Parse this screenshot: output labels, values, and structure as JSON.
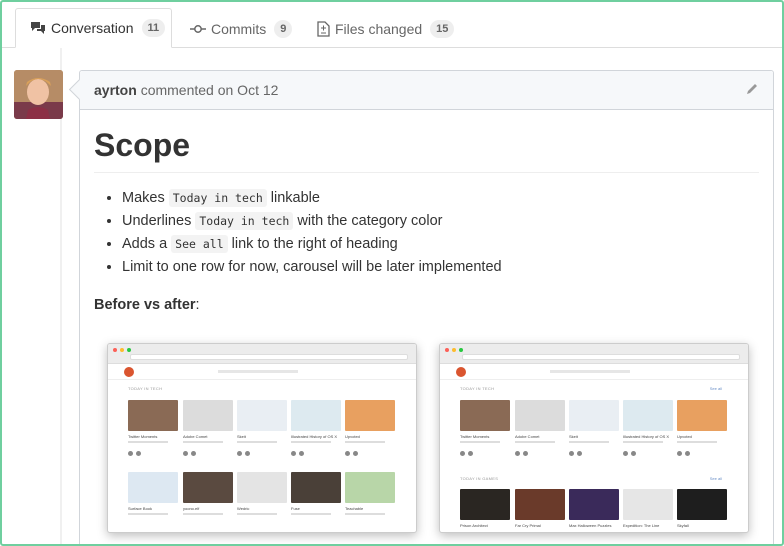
{
  "tabs": [
    {
      "label": "Conversation",
      "count": "11",
      "icon": "conversation-icon"
    },
    {
      "label": "Commits",
      "count": "9",
      "icon": "commit-icon"
    },
    {
      "label": "Files changed",
      "count": "15",
      "icon": "file-diff-icon"
    }
  ],
  "comment": {
    "author": "ayrton",
    "action": "commented on Oct 12",
    "heading": "Scope",
    "items": [
      {
        "pre": "Makes ",
        "code": "Today in tech",
        "post": " linkable"
      },
      {
        "pre": "Underlines ",
        "code": "Today in tech",
        "post": " with the category color"
      },
      {
        "pre": "Adds a ",
        "code": "See all",
        "post": " link to the right of heading"
      },
      {
        "pre": "Limit to one row for now, carousel will be later implemented",
        "code": "",
        "post": ""
      }
    ],
    "before_after_label": "Before vs after",
    "before_after_colon": ":"
  },
  "screenshots": {
    "before": {
      "section": "TODAY IN TECH",
      "row1": [
        "Twitter Moments",
        "Adobe Comet",
        "Skeit",
        "Illustrated History of OS X",
        "Upvoted"
      ],
      "row2": [
        "Surface Book",
        "yoono.elf",
        "Wedric",
        "Fuse",
        "Teachable"
      ]
    },
    "after": {
      "section": "TODAY IN TECH",
      "see_all": "See all",
      "row1": [
        "Twitter Moments",
        "Adobe Comet",
        "Skeit",
        "Illustrated History of OS X",
        "Upvoted"
      ],
      "section2": "TODAY IN GAMES",
      "see_all2": "See all",
      "row2": [
        "Prison Architect",
        "Far Cry Primal",
        "Max Halloween Puzzles",
        "Expedition: The Line",
        "Skyfall"
      ]
    }
  },
  "colors": {
    "frame_border": "#6fcf9f",
    "brand_ph": "#da552f"
  }
}
